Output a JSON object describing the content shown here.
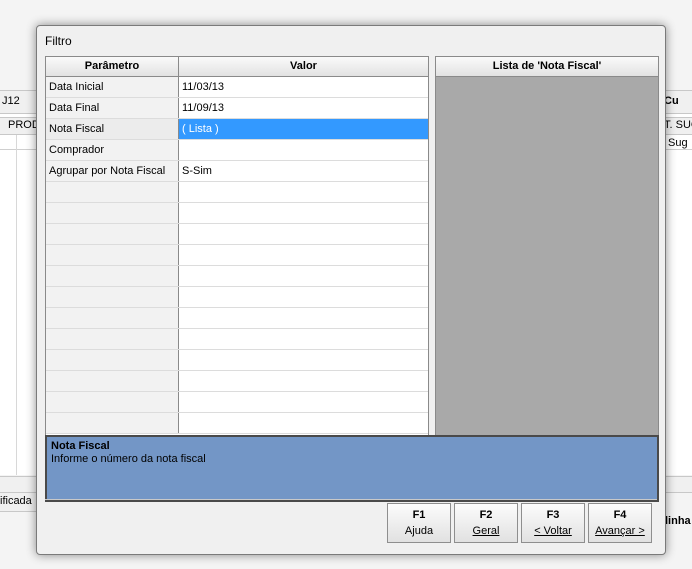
{
  "background": {
    "left_field": "J12",
    "column_prod": "PROD",
    "right_label": "Cu",
    "right_col1": "T. SUG",
    "right_col2": "Sug",
    "bottom_left": "ificada",
    "bottom_right": "linha"
  },
  "dialog": {
    "title": "Filtro",
    "columns": {
      "param": "Parâmetro",
      "value": "Valor"
    },
    "rows": [
      {
        "param": "Data Inicial",
        "value": "11/03/13"
      },
      {
        "param": "Data Final",
        "value": "11/09/13"
      },
      {
        "param": "Nota Fiscal",
        "value": "( Lista )"
      },
      {
        "param": "Comprador",
        "value": ""
      },
      {
        "param": "Agrupar por Nota Fiscal",
        "value": "S-Sim"
      }
    ],
    "list_title": "Lista de 'Nota Fiscal'",
    "help": {
      "title": "Nota Fiscal",
      "text": "Informe o número da nota fiscal"
    },
    "buttons": [
      {
        "key": "F1",
        "label": "Ajuda"
      },
      {
        "key": "F2",
        "label": "Geral"
      },
      {
        "key": "F3",
        "label": "< Voltar"
      },
      {
        "key": "F4",
        "label": "Avançar >"
      }
    ],
    "colors": {
      "selection": "#3399ff",
      "help_bg": "#7396c6",
      "list_bg": "#a9a9a9"
    }
  }
}
